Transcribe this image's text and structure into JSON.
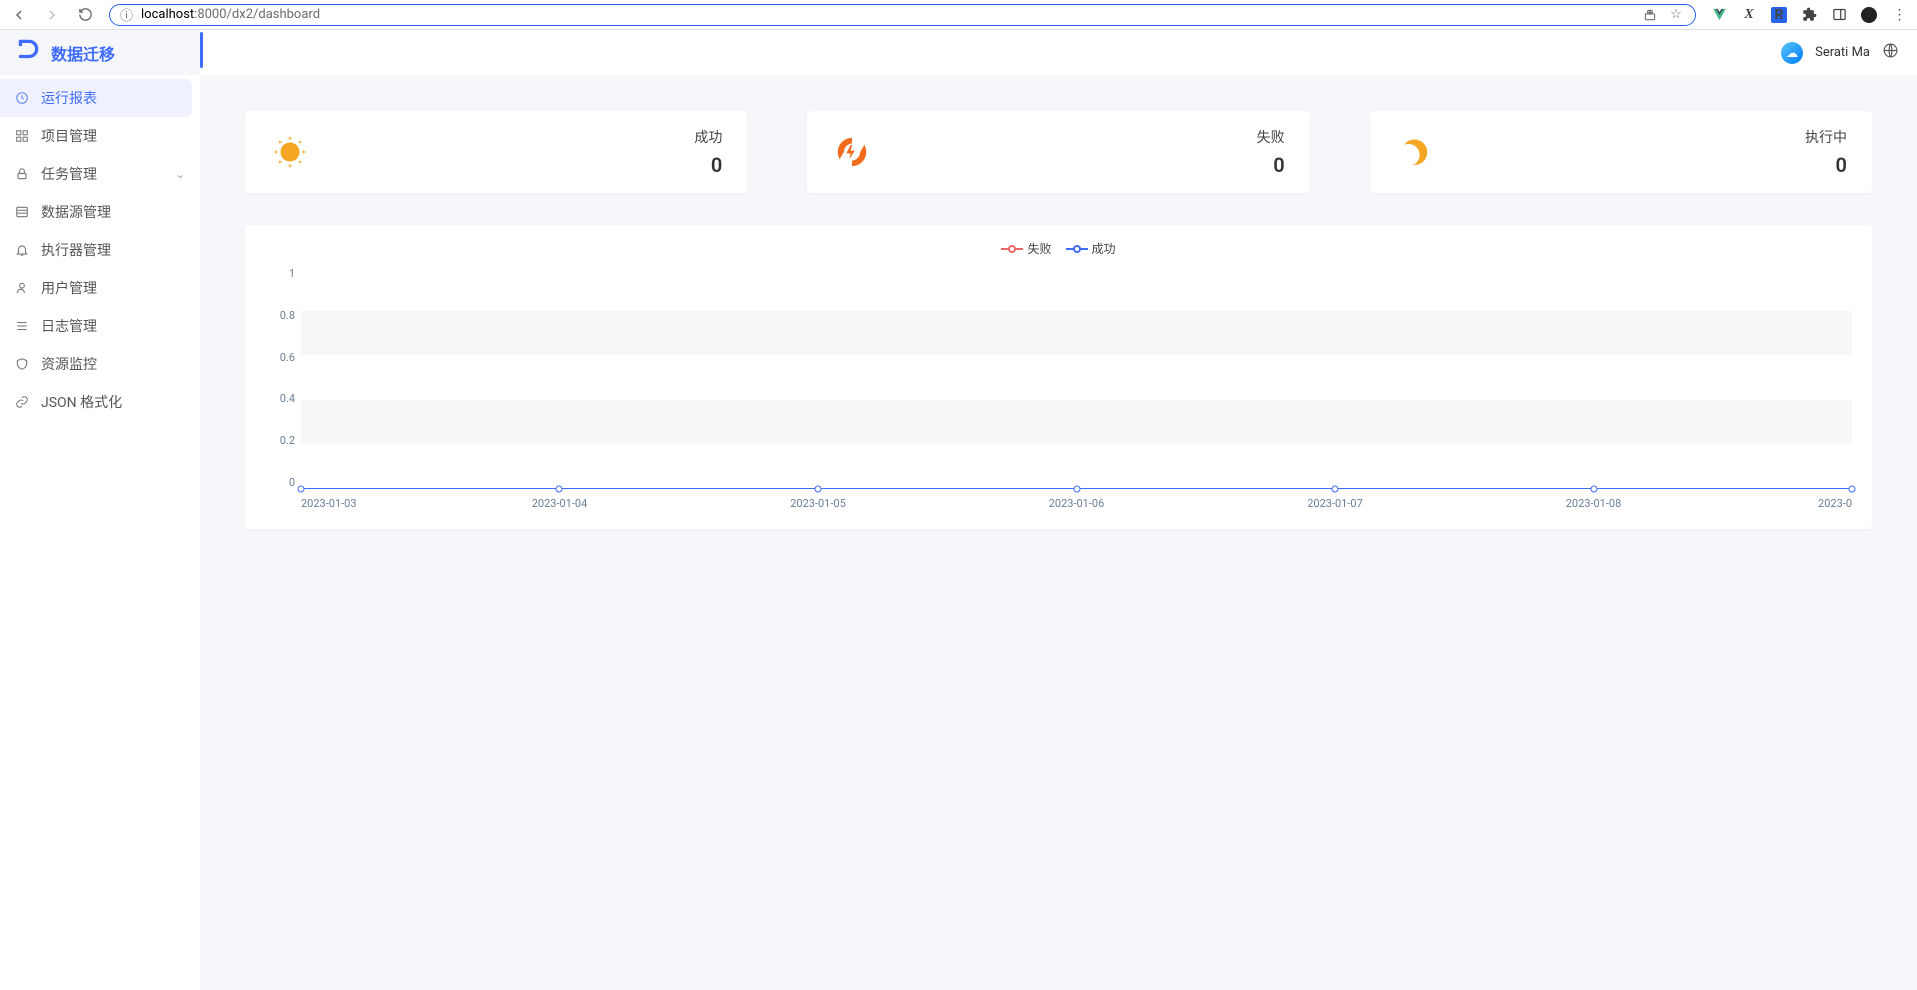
{
  "browser": {
    "url_prefix": "localhost",
    "url_suffix": ":8000/dx2/dashboard"
  },
  "app": {
    "title": "数据迁移"
  },
  "user": {
    "name": "Serati Ma"
  },
  "sidebar": {
    "items": [
      {
        "label": "运行报表",
        "icon": "dashboard",
        "active": true
      },
      {
        "label": "项目管理",
        "icon": "appstore"
      },
      {
        "label": "任务管理",
        "icon": "lock",
        "expandable": true
      },
      {
        "label": "数据源管理",
        "icon": "list"
      },
      {
        "label": "执行器管理",
        "icon": "bell"
      },
      {
        "label": "用户管理",
        "icon": "user"
      },
      {
        "label": "日志管理",
        "icon": "bars"
      },
      {
        "label": "资源监控",
        "icon": "shield"
      },
      {
        "label": "JSON 格式化",
        "icon": "link"
      }
    ]
  },
  "stats": [
    {
      "label": "成功",
      "value": "0",
      "icon": "sun"
    },
    {
      "label": "失败",
      "value": "0",
      "icon": "bolt"
    },
    {
      "label": "执行中",
      "value": "0",
      "icon": "moon"
    }
  ],
  "chart_data": {
    "type": "line",
    "title": "",
    "xlabel": "",
    "ylabel": "",
    "ylim": [
      0,
      1
    ],
    "y_ticks": [
      "1",
      "0.8",
      "0.6",
      "0.4",
      "0.2",
      "0"
    ],
    "categories": [
      "2023-01-03",
      "2023-01-04",
      "2023-01-05",
      "2023-01-06",
      "2023-01-07",
      "2023-01-08",
      "2023-0"
    ],
    "series": [
      {
        "name": "失败",
        "color": "#ee6666",
        "values": [
          0,
          0,
          0,
          0,
          0,
          0,
          0
        ]
      },
      {
        "name": "成功",
        "color": "#3f6cff",
        "values": [
          0,
          0,
          0,
          0,
          0,
          0,
          0
        ]
      }
    ]
  }
}
